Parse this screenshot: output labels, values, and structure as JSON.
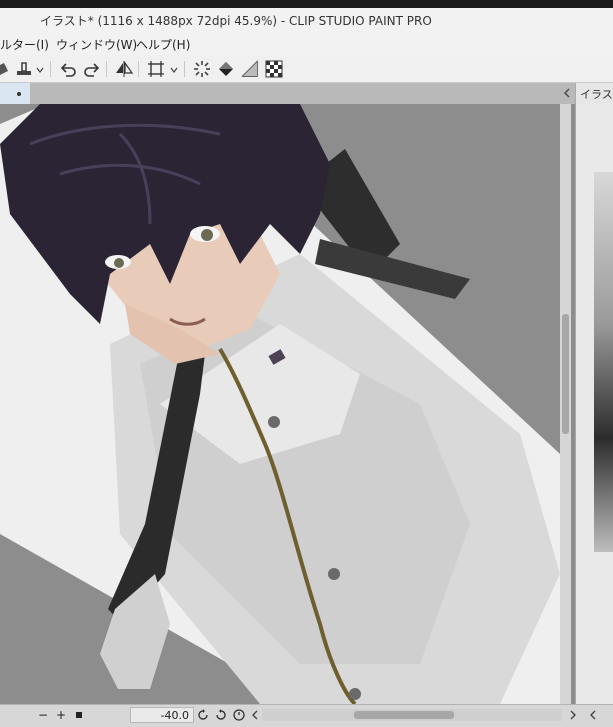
{
  "window": {
    "title": "イラスト* (1116 x 1488px 72dpi 45.9%)  - CLIP STUDIO PAINT PRO"
  },
  "menubar": {
    "items": [
      {
        "label": "ルター(I)"
      },
      {
        "label": "ウィンドウ(W)"
      },
      {
        "label": "ヘルプ(H)"
      }
    ]
  },
  "tabs": {
    "active_marker": "●",
    "right_panel_label": "イラスト*"
  },
  "status": {
    "zoom_out": "−",
    "zoom_in": "+",
    "rotation_angle": "-40.0"
  },
  "icons": {
    "bucket": "bucket-icon",
    "stamp": "stamp-icon",
    "undo": "undo-icon",
    "redo": "redo-icon",
    "flip": "flip-horizontal-icon",
    "transform": "transform-icon",
    "loading": "spinner-icon",
    "fill": "fill-icon",
    "ruler": "ruler-icon",
    "transparency": "checker-icon"
  },
  "colors": {
    "canvas_bg": "#8d8d8d",
    "hair": "#2b2434",
    "jacket": "#dcdcdc",
    "trim": "#8a7a3c",
    "suspender": "#2d2d2d"
  }
}
